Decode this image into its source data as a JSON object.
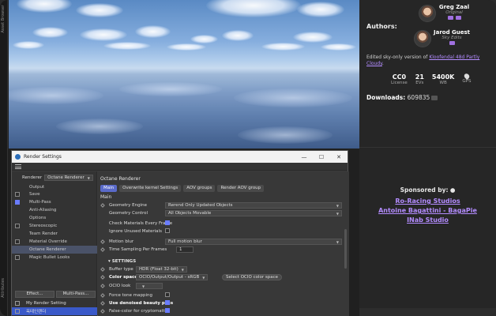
{
  "left_strip": {
    "top_label": "Asset Browser",
    "bottom_label": "Attributes"
  },
  "info": {
    "authors_label": "Authors:",
    "authors": [
      {
        "name": "Greg Zaal",
        "role": "Original"
      },
      {
        "name": "Jarod Guest",
        "role": "Sky Edits"
      }
    ],
    "description_prefix": "Edited sky-only version of ",
    "description_link": "Kloofendal 48d Partly Cloudy",
    "description_suffix": ".",
    "stats": [
      {
        "value": "CC0",
        "label": "License"
      },
      {
        "value": "21",
        "label": "EVs"
      },
      {
        "value": "5400K",
        "label": "WB"
      },
      {
        "value": "",
        "label": "GPS"
      }
    ],
    "downloads_label": "Downloads:",
    "downloads_value": "609835",
    "sponsored_label": "Sponsored by:",
    "sponsors": [
      "Ro-Racing Studios",
      "Antoine Bagattini - BagaPie",
      "INab Studio"
    ]
  },
  "window": {
    "title": "Render Settings",
    "renderer_label": "Renderer",
    "renderer_value": "Octane Renderer",
    "left_items": [
      {
        "label": "Output",
        "checkbox": false,
        "checked": false
      },
      {
        "label": "Save",
        "checkbox": true,
        "checked": false
      },
      {
        "label": "Multi-Pass",
        "checkbox": true,
        "checked": true
      },
      {
        "label": "Anti-Aliasing",
        "checkbox": false,
        "checked": false
      },
      {
        "label": "Options",
        "checkbox": false,
        "checked": false
      },
      {
        "label": "Stereoscopic",
        "checkbox": true,
        "checked": false
      },
      {
        "label": "Team Render",
        "checkbox": false,
        "checked": false
      },
      {
        "label": "Material Override",
        "checkbox": true,
        "checked": false
      },
      {
        "label": "Octane Renderer",
        "checkbox": false,
        "checked": false,
        "selected": true
      },
      {
        "label": "Magic Bullet Looks",
        "checkbox": true,
        "checked": false
      }
    ],
    "effect_button": "Effect...",
    "multipass_button": "Multi-Pass...",
    "footer_items": [
      {
        "label": "My Render Setting",
        "selected": false
      },
      {
        "label": "옥테인랜더",
        "selected": true
      }
    ],
    "panel_title": "Octane Renderer",
    "tabs": [
      "Main",
      "Overwrite kernel Settings",
      "AOV groups",
      "Render AOV group"
    ],
    "active_tab": "Main",
    "main_label": "Main",
    "geometry_engine_label": "Geometry Engine",
    "geometry_engine_value": "Rerend Only Updated Objects",
    "geometry_control_label": "Geometry Control",
    "geometry_control_value": "All Objects Movable",
    "check_materials_label": "Check Materials Every Frame",
    "ignore_unused_label": "Ignore Unused Materials",
    "motion_blur_label": "Motion blur",
    "motion_blur_value": "Full motion blur",
    "time_sampling_label": "Time Sampling Per Frames",
    "time_sampling_value": "1",
    "settings_head": "SETTINGS",
    "buffer_type_label": "Buffer type",
    "buffer_type_value": "HDR (Float 32-bit)",
    "color_space_label": "Color space",
    "color_space_value": "OCIO/Output/Output - sRGB",
    "select_ocio_button": "Select OCIO color space",
    "ocio_look_label": "OCIO look",
    "force_tone_label": "Force tone mapping",
    "use_denoised_label": "Use denoised beauty pass",
    "false_color_label": "False-color for cryptomatte"
  }
}
